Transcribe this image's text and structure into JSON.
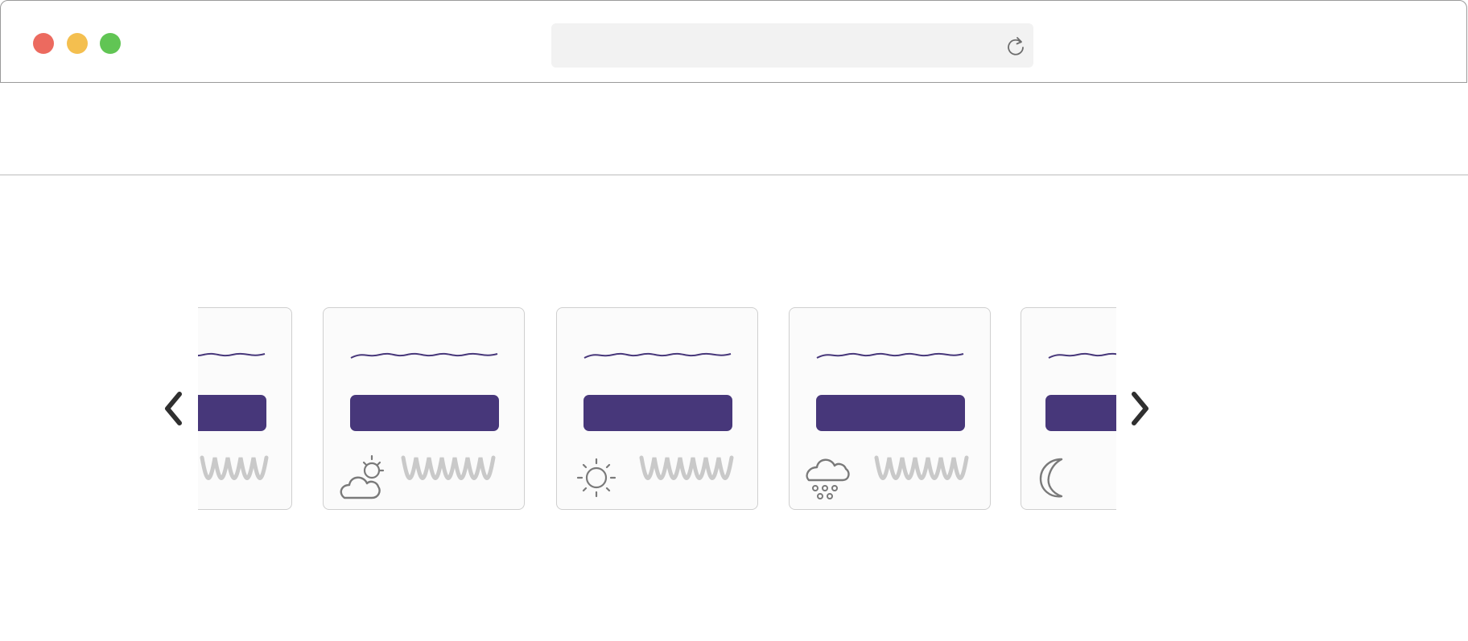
{
  "window": {
    "traffic_lights": [
      {
        "name": "close",
        "color": "#ec6a5f"
      },
      {
        "name": "minimize",
        "color": "#f4bf4f"
      },
      {
        "name": "maximize",
        "color": "#61c554"
      }
    ],
    "address_bar": {
      "text": ""
    },
    "reload_icon": "reload-icon"
  },
  "colors": {
    "accent": "#47377a",
    "card_bg": "#fbfbfb",
    "scribble": "#c9c9c9",
    "icon_stroke": "#7a7a7a"
  },
  "carousel": {
    "prev_icon": "chevron-left-icon",
    "next_icon": "chevron-right-icon",
    "cards": [
      {
        "title": "",
        "button_label": "",
        "weather_icon": "",
        "partial": "left"
      },
      {
        "title": "",
        "button_label": "",
        "weather_icon": "partly-cloudy-icon"
      },
      {
        "title": "",
        "button_label": "",
        "weather_icon": "sun-icon"
      },
      {
        "title": "",
        "button_label": "",
        "weather_icon": "snow-icon"
      },
      {
        "title": "",
        "button_label": "",
        "weather_icon": "moon-icon",
        "partial": "right"
      }
    ]
  }
}
